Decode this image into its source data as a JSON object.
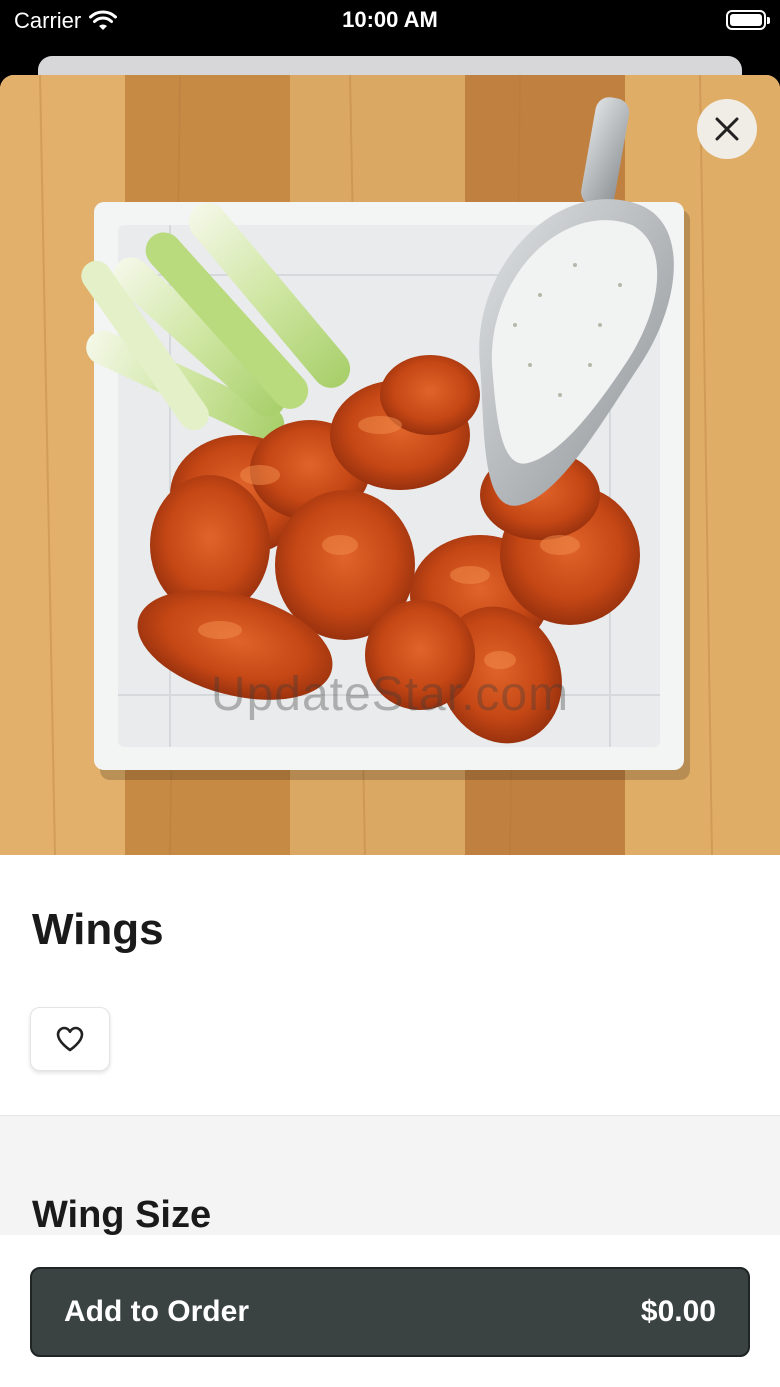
{
  "status_bar": {
    "carrier": "Carrier",
    "time": "10:00 AM",
    "wifi_icon": "wifi-icon",
    "battery_icon": "battery-icon"
  },
  "item": {
    "title": "Wings",
    "image_icon": "food-photo",
    "watermark": "UpdateStar.com"
  },
  "actions": {
    "close_icon": "close-icon",
    "favorite_icon": "heart-outline-icon"
  },
  "options": {
    "section_title": "Wing Size"
  },
  "footer": {
    "add_label": "Add to Order",
    "price": "$0.00"
  },
  "colors": {
    "button_bg": "#3a4242",
    "close_bg": "#f0ece6",
    "section_bg": "#f4f4f4"
  }
}
